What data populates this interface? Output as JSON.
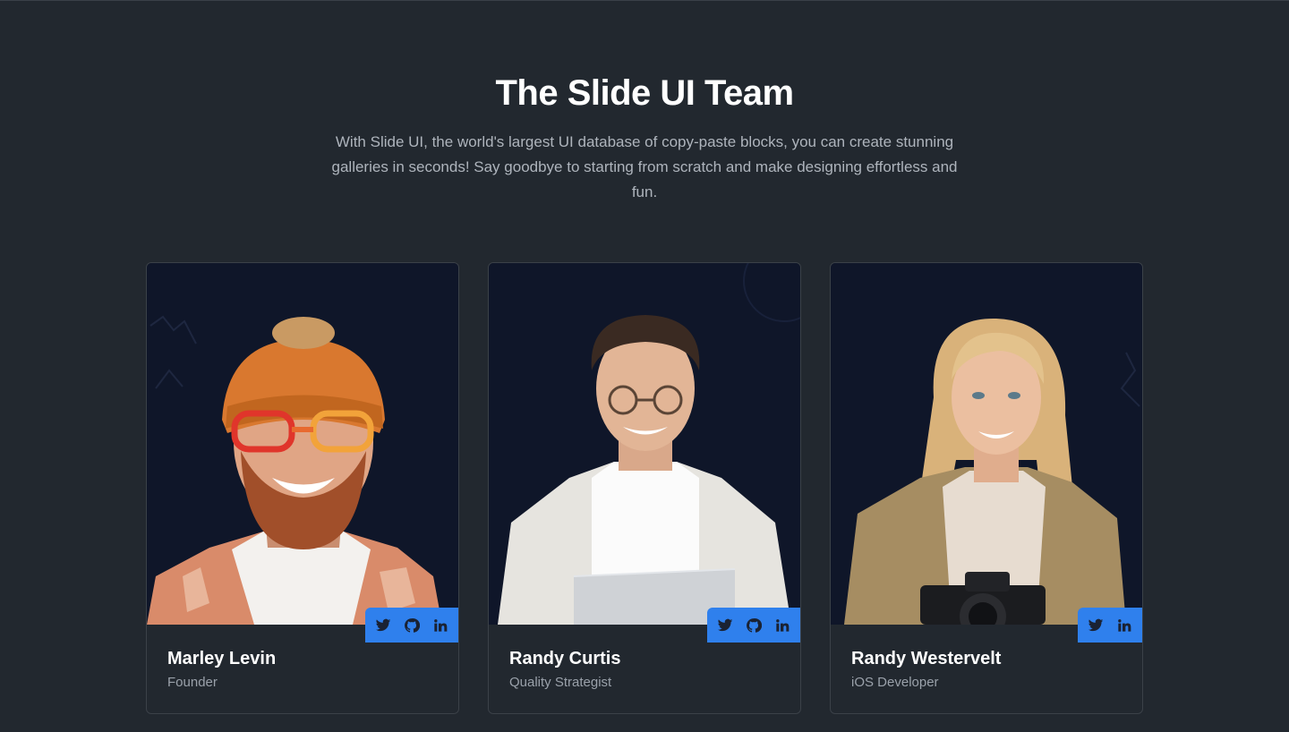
{
  "header": {
    "title": "The Slide UI Team",
    "description": "With Slide UI, the world's largest UI database of copy-paste blocks, you can create stunning galleries in seconds! Say goodbye to starting from scratch and make designing effortless and fun."
  },
  "colors": {
    "page_background": "#22282f",
    "card_photo_background": "#0f1629",
    "social_bar": "#2f80ed",
    "role_text": "#9aa1aa"
  },
  "team": [
    {
      "name": "Marley Levin",
      "role": "Founder",
      "photo": "portrait of a smiling bearded man with orange beanie and red glasses",
      "socials": [
        "twitter-icon",
        "github-icon",
        "linkedin-icon"
      ]
    },
    {
      "name": "Randy Curtis",
      "role": "Quality Strategist",
      "photo": "portrait of a smiling man with round glasses holding a laptop",
      "socials": [
        "twitter-icon",
        "github-icon",
        "linkedin-icon"
      ]
    },
    {
      "name": "Randy Westervelt",
      "role": "iOS Developer",
      "photo": "portrait of a smiling blonde woman holding a camera",
      "socials": [
        "twitter-icon",
        "linkedin-icon"
      ]
    }
  ]
}
